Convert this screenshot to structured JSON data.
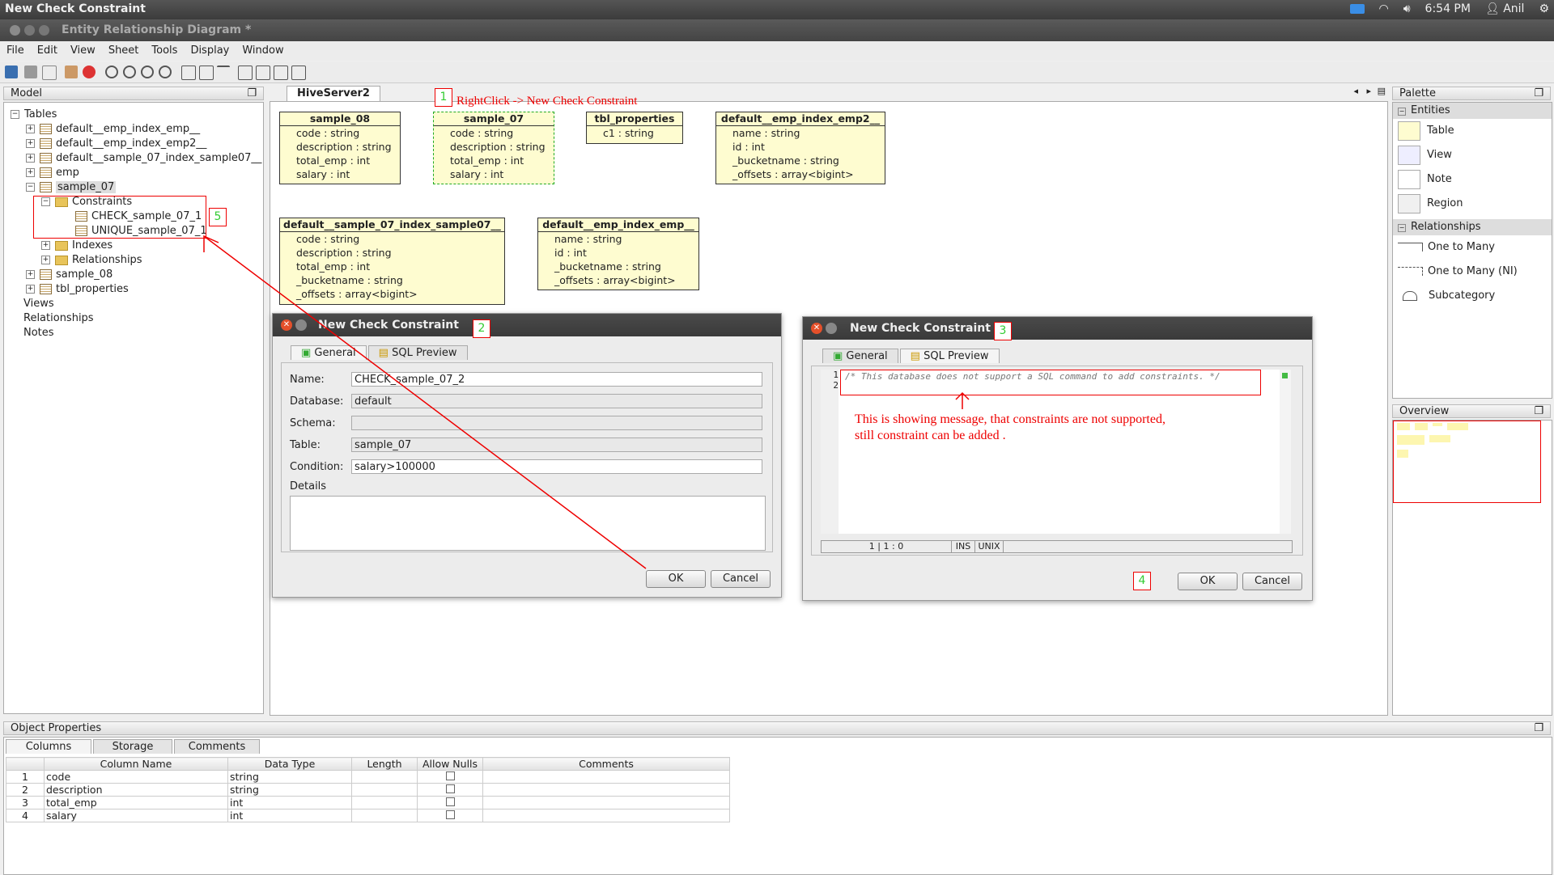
{
  "system": {
    "title": "New Check Constraint",
    "time": "6:54 PM",
    "user": "Anil"
  },
  "window": {
    "title": "Entity Relationship Diagram *"
  },
  "menu": [
    "File",
    "Edit",
    "View",
    "Sheet",
    "Tools",
    "Display",
    "Window"
  ],
  "model": {
    "header": "Model",
    "tree": {
      "tables": "Tables",
      "t1": "default__emp_index_emp__",
      "t2": "default__emp_index_emp2__",
      "t3": "default__sample_07_index_sample07__",
      "t4": "emp",
      "t5": "sample_07",
      "constraints": "Constraints",
      "c1": "CHECK_sample_07_1",
      "c2": "UNIQUE_sample_07_1",
      "indexes": "Indexes",
      "relationships": "Relationships",
      "t6": "sample_08",
      "t7": "tbl_properties",
      "views": "Views",
      "rels": "Relationships",
      "notes": "Notes"
    }
  },
  "canvas": {
    "tab": "HiveServer2"
  },
  "entities": {
    "e1": {
      "name": "sample_08",
      "rows": [
        "code : string",
        "description : string",
        "total_emp : int",
        "salary : int"
      ]
    },
    "e2": {
      "name": "sample_07",
      "rows": [
        "code : string",
        "description : string",
        "total_emp : int",
        "salary : int"
      ]
    },
    "e3": {
      "name": "tbl_properties",
      "rows": [
        "c1 : string"
      ]
    },
    "e4": {
      "name": "default__emp_index_emp2__",
      "rows": [
        "name : string",
        "id : int",
        "_bucketname : string",
        "_offsets : array<bigint>"
      ]
    },
    "e5": {
      "name": "default__sample_07_index_sample07__",
      "rows": [
        "code : string",
        "description : string",
        "total_emp : int",
        "_bucketname : string",
        "_offsets : array<bigint>"
      ]
    },
    "e6": {
      "name": "default__emp_index_emp__",
      "rows": [
        "name : string",
        "id : int",
        "_bucketname : string",
        "_offsets : array<bigint>"
      ]
    }
  },
  "annotations": {
    "n1": "1",
    "n2": "2",
    "n3": "3",
    "n4": "4",
    "n5": "5",
    "rightclick": "RightClick -> New Check Constraint",
    "msg_line1": "This is showing message, that constraints are not supported,",
    "msg_line2": "still constraint can be added ."
  },
  "dialog1": {
    "title": "New Check Constraint",
    "tab_general": "General",
    "tab_sql": "SQL Preview",
    "name_label": "Name:",
    "name_value": "CHECK_sample_07_2",
    "database_label": "Database:",
    "database_value": "default",
    "schema_label": "Schema:",
    "schema_value": "",
    "table_label": "Table:",
    "table_value": "sample_07",
    "condition_label": "Condition:",
    "condition_value": "salary>100000",
    "details_label": "Details",
    "ok": "OK",
    "cancel": "Cancel"
  },
  "dialog2": {
    "title": "New Check Constraint",
    "tab_general": "General",
    "tab_sql": "SQL Preview",
    "line1": "1",
    "line2": "2",
    "sql": "/* This database does not support a SQL command to add constraints. */",
    "status_pos": "1 | 1 : 0",
    "status_ins": "INS",
    "status_unix": "UNIX",
    "ok": "OK",
    "cancel": "Cancel"
  },
  "palette": {
    "header": "Palette",
    "entities": "Entities",
    "items": [
      "Table",
      "View",
      "Note",
      "Region"
    ],
    "relationships": "Relationships",
    "rel_items": [
      "One to Many",
      "One to Many (NI)",
      "Subcategory"
    ]
  },
  "overview": {
    "header": "Overview"
  },
  "props": {
    "header": "Object Properties",
    "tabs": [
      "Columns",
      "Storage",
      "Comments"
    ],
    "columns": [
      "Column Name",
      "Data Type",
      "Length",
      "Allow Nulls",
      "Comments"
    ],
    "rows": [
      {
        "n": "1",
        "name": "code",
        "type": "string"
      },
      {
        "n": "2",
        "name": "description",
        "type": "string"
      },
      {
        "n": "3",
        "name": "total_emp",
        "type": "int"
      },
      {
        "n": "4",
        "name": "salary",
        "type": "int"
      }
    ]
  }
}
